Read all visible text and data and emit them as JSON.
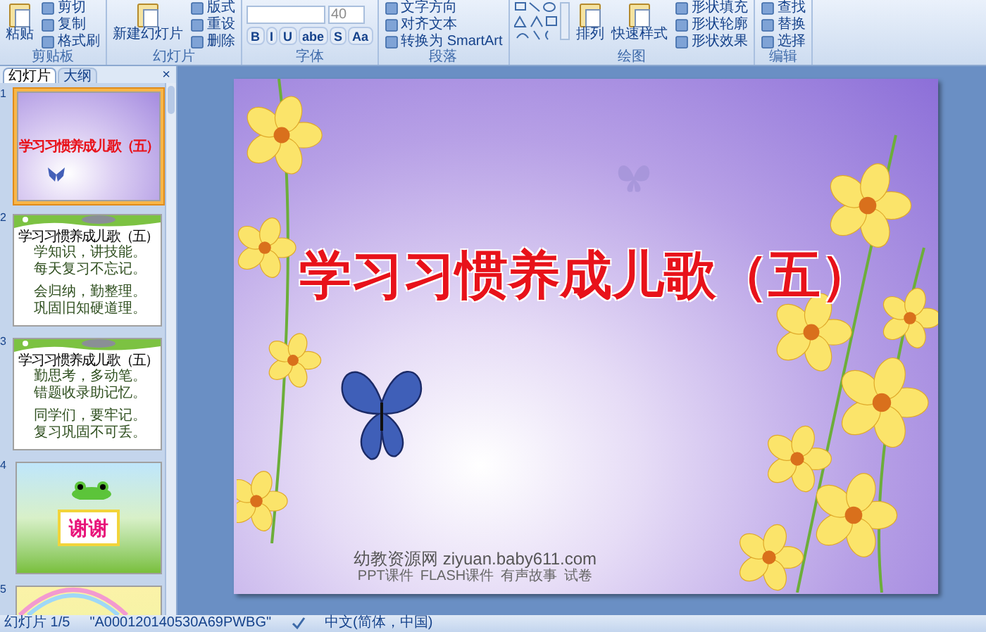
{
  "ribbon": {
    "groups": [
      {
        "label": "剪贴板",
        "large": [
          "粘贴"
        ],
        "small": [
          "剪切",
          "复制",
          "格式刷"
        ]
      },
      {
        "label": "幻灯片",
        "large": [
          "新建幻灯片"
        ],
        "small": [
          "版式",
          "重设",
          "删除"
        ]
      },
      {
        "label": "字体",
        "font_size": "40",
        "format_buttons": [
          "B",
          "I",
          "U",
          "abe",
          "S",
          "Aa"
        ]
      },
      {
        "label": "段落",
        "small": [
          "文字方向",
          "对齐文本",
          "转换为 SmartArt"
        ]
      },
      {
        "label": "绘图",
        "large": [
          "排列",
          "快速样式"
        ],
        "small": [
          "形状填充",
          "形状轮廓",
          "形状效果"
        ]
      },
      {
        "label": "编辑",
        "small": [
          "查找",
          "替换",
          "选择"
        ]
      }
    ]
  },
  "panel": {
    "tabs": [
      {
        "label": "幻灯片",
        "selected": true
      },
      {
        "label": "大纲",
        "selected": false
      }
    ],
    "close": "×",
    "slides": [
      {
        "number": "1",
        "kind": "title",
        "selected": true,
        "title": "学习习惯养成儿歌（五）"
      },
      {
        "number": "2",
        "kind": "text",
        "selected": false,
        "title": "学习习惯养成儿歌（五）",
        "lines": [
          "学知识，讲技能。",
          "每天复习不忘记。",
          "会归纳，勤整理。",
          "巩固旧知硬道理。"
        ]
      },
      {
        "number": "3",
        "kind": "text",
        "selected": false,
        "title": "学习习惯养成儿歌（五）",
        "lines": [
          "勤思考，多动笔。",
          "错题收录助记忆。",
          "同学们，要牢记。",
          "复习巩固不可丢。"
        ]
      },
      {
        "number": "4",
        "kind": "thanks",
        "selected": false,
        "text": "谢谢"
      },
      {
        "number": "5",
        "kind": "rainbow",
        "selected": false
      }
    ]
  },
  "slide": {
    "title": "学习习惯养成儿歌（五）",
    "site": "幼教资源网 ziyuan.baby611.com",
    "links": [
      "PPT课件",
      "FLASH课件",
      "有声故事",
      "试卷"
    ]
  },
  "status_bar": {
    "slide_count": "幻灯片 1/5",
    "theme": "\"A000120140530A69PWBG\"",
    "language": "中文(简体，中国)"
  }
}
